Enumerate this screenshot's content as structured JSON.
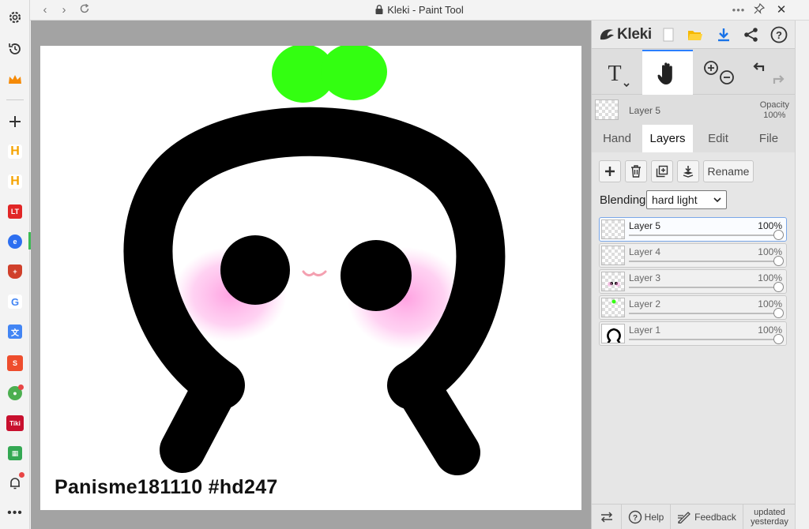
{
  "window": {
    "title": "Kleki - Paint Tool"
  },
  "browser_sidebar": {
    "icons": [
      "gear-icon",
      "history-icon",
      "crown-icon",
      "add-icon",
      "h-app-icon",
      "h-app-icon",
      "lt-app-icon",
      "blue-app-icon",
      "shield-app-icon",
      "google-icon",
      "translate-icon",
      "shopee-icon",
      "green-app-icon",
      "tiki-icon",
      "sheets-icon",
      "bell-icon",
      "more-icon"
    ],
    "tiki_label": "Tiki",
    "lt_label": "LT"
  },
  "canvas": {
    "signature_text": "Panisme181110 #hd247"
  },
  "panel": {
    "logo_text": "Kleki",
    "layer_name": "Layer 5",
    "opacity_label": "Opacity",
    "opacity_value": "100%",
    "tabs": [
      {
        "label": "Hand",
        "active": false
      },
      {
        "label": "Layers",
        "active": true
      },
      {
        "label": "Edit",
        "active": false
      },
      {
        "label": "File",
        "active": false
      }
    ],
    "rename_label": "Rename",
    "blending_label": "Blending",
    "blending_value": "hard light",
    "layers": [
      {
        "name": "Layer 5",
        "opacity": "100%",
        "level": 1,
        "selected": true
      },
      {
        "name": "Layer 4",
        "opacity": "100%",
        "level": 1,
        "selected": false
      },
      {
        "name": "Layer 3",
        "opacity": "100%",
        "level": 1,
        "selected": false
      },
      {
        "name": "Layer 2",
        "opacity": "100%",
        "level": 1,
        "selected": false
      },
      {
        "name": "Layer 1",
        "opacity": "100%",
        "level": 1,
        "selected": false
      }
    ],
    "bottom": {
      "help_label": "Help",
      "feedback_label": "Feedback",
      "updated_line1": "updated",
      "updated_line2": "yesterday"
    }
  },
  "colors": {
    "accent": "#2a7fff",
    "sprout": "#33ff11",
    "blush": "#ff9ee0",
    "mouth": "#f4a0b0"
  }
}
